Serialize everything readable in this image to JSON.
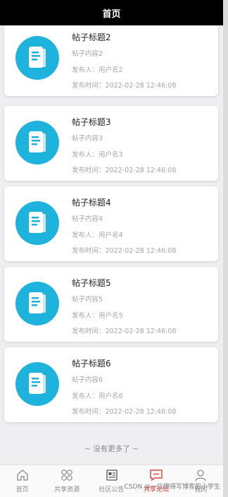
{
  "header": {
    "title": "首页"
  },
  "posts": [
    {
      "title": "帖子标题2",
      "content": "帖子内容2",
      "author": "发布人：用户名2",
      "time": "发布时间：2022-02-28 12:46:08"
    },
    {
      "title": "帖子标题3",
      "content": "帖子内容3",
      "author": "发布人：用户名3",
      "time": "发布时间：2022-02-28 12:46:08"
    },
    {
      "title": "帖子标题4",
      "content": "帖子内容4",
      "author": "发布人：用户名4",
      "time": "发布时间：2022-02-28 12:46:08"
    },
    {
      "title": "帖子标题5",
      "content": "帖子内容5",
      "author": "发布人：用户名5",
      "time": "发布时间：2022-02-28 12:46:08"
    },
    {
      "title": "帖子标题6",
      "content": "帖子内容6",
      "author": "发布人：用户名6",
      "time": "发布时间：2022-02-28 12:46:08"
    }
  ],
  "footer_text": "~ 没有更多了 ~",
  "tabbar": {
    "items": [
      {
        "label": "首页",
        "icon": "home-icon"
      },
      {
        "label": "共享资源",
        "icon": "grid-icon"
      },
      {
        "label": "社区公告",
        "icon": "notice-icon"
      },
      {
        "label": "共享论坛",
        "icon": "chat-icon",
        "active": true
      },
      {
        "label": "我的",
        "icon": "user-icon"
      }
    ]
  },
  "watermark": "CSDN @一位懒得写博客的小学生",
  "colors": {
    "accent": "#e0453a",
    "avatar_bg": "#1eb3dd",
    "header_bg": "#000000"
  }
}
